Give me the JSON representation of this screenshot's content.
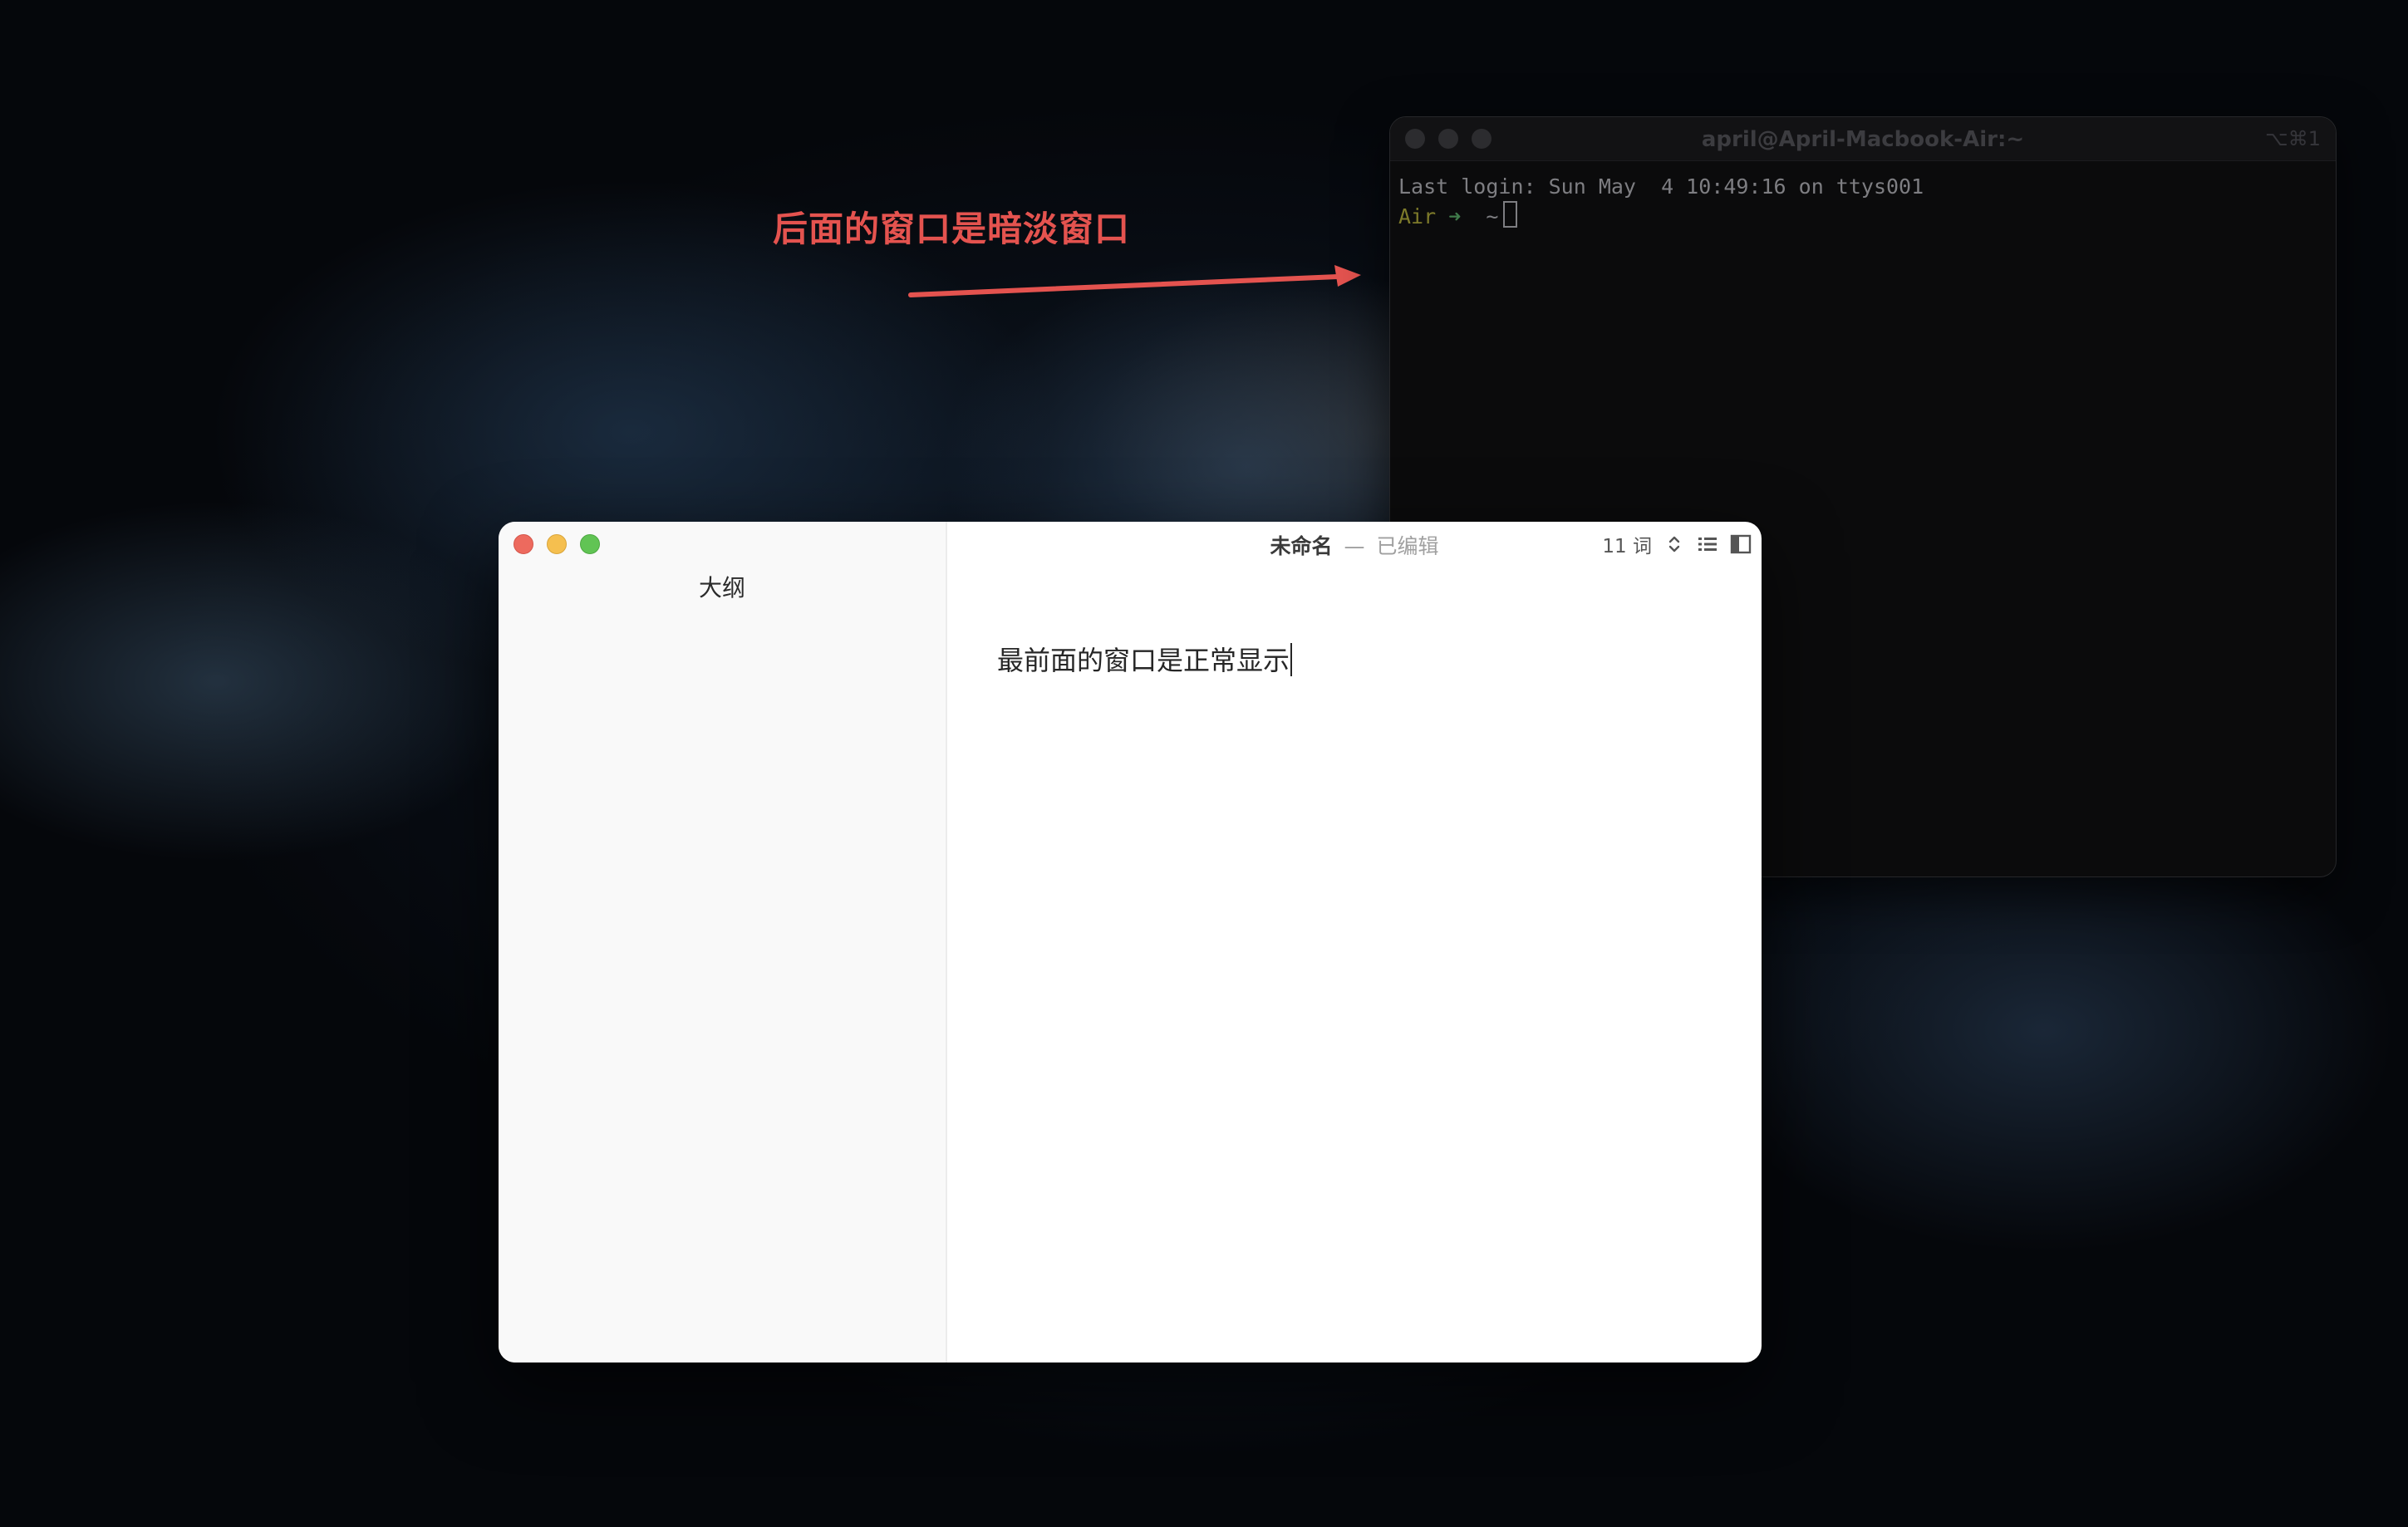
{
  "annotation": {
    "text": "后面的窗口是暗淡窗口",
    "color": "#e4534f"
  },
  "terminal": {
    "title": "april@April-Macbook-Air:~",
    "shortcut": "⌥⌘1",
    "last_login": "Last login: Sun May  4 10:49:16 on ttys001",
    "prompt_host": "Air",
    "prompt_arrow": "➜",
    "prompt_dir": "~"
  },
  "editor": {
    "sidebar_title": "大纲",
    "doc_name": "未命名",
    "doc_separator": "—",
    "doc_status": "已编辑",
    "word_count": "11 词",
    "content": "最前面的窗口是正常显示"
  },
  "icons": {
    "stepper": "chevron-up-down-icon",
    "outline": "list-icon",
    "sidebar_toggle": "sidebar-icon"
  },
  "colors": {
    "close": "#ed6a5e",
    "minimize": "#f5bf4f",
    "maximize": "#61c454"
  }
}
